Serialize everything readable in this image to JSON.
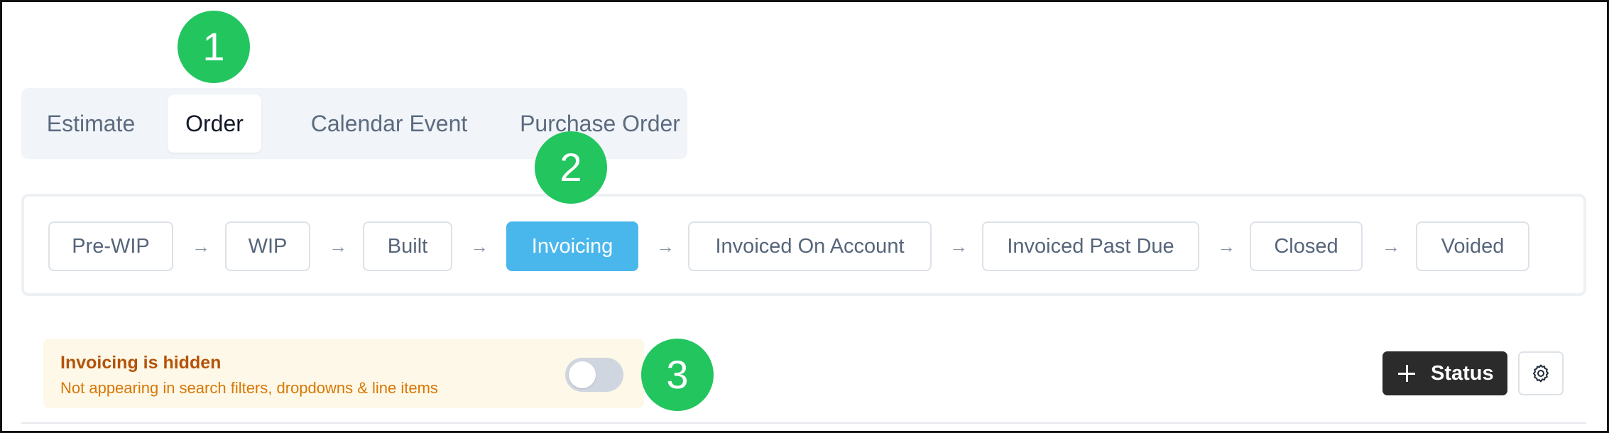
{
  "tabs": [
    {
      "label": "Estimate",
      "active": false
    },
    {
      "label": "Order",
      "active": true
    },
    {
      "label": "Calendar Event",
      "active": false
    },
    {
      "label": "Purchase Order",
      "active": false
    }
  ],
  "callouts": [
    "1",
    "2",
    "3"
  ],
  "statuses": [
    {
      "label": "Pre-WIP",
      "active": false
    },
    {
      "label": "WIP",
      "active": false
    },
    {
      "label": "Built",
      "active": false
    },
    {
      "label": "Invoicing",
      "active": true
    },
    {
      "label": "Invoiced On Account",
      "active": false
    },
    {
      "label": "Invoiced Past Due",
      "active": false
    },
    {
      "label": "Closed",
      "active": false
    },
    {
      "label": "Voided",
      "active": false
    }
  ],
  "arrow_glyph": "→",
  "notice": {
    "title": "Invoicing is hidden",
    "subtitle": "Not appearing in search filters, dropdowns & line items",
    "toggle_on": false
  },
  "actions": {
    "add_status_label": "Status",
    "add_icon": "plus-icon",
    "settings_icon": "gear-icon"
  },
  "colors": {
    "active_status": "#4ab7ec",
    "callout": "#22c55e",
    "notice_bg": "#fdf8e7",
    "notice_title": "#b45309",
    "primary_button": "#2b2b2b"
  }
}
